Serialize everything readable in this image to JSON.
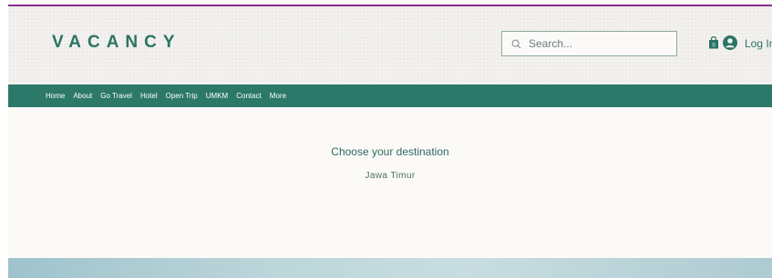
{
  "header": {
    "logo": "VACANCY",
    "search_placeholder": "Search...",
    "cart_count": "0",
    "login_label": "Log In"
  },
  "nav": {
    "items": [
      "Home",
      "About",
      "Go Travel",
      "Hotel",
      "Open Trip",
      "UMKM",
      "Contact",
      "More"
    ]
  },
  "main": {
    "title": "Choose your destination",
    "subtitle": "Jawa Timur"
  },
  "colors": {
    "brand": "#2b7464",
    "nav_bg": "#2c7869",
    "top_accent": "#8a2c8f"
  }
}
